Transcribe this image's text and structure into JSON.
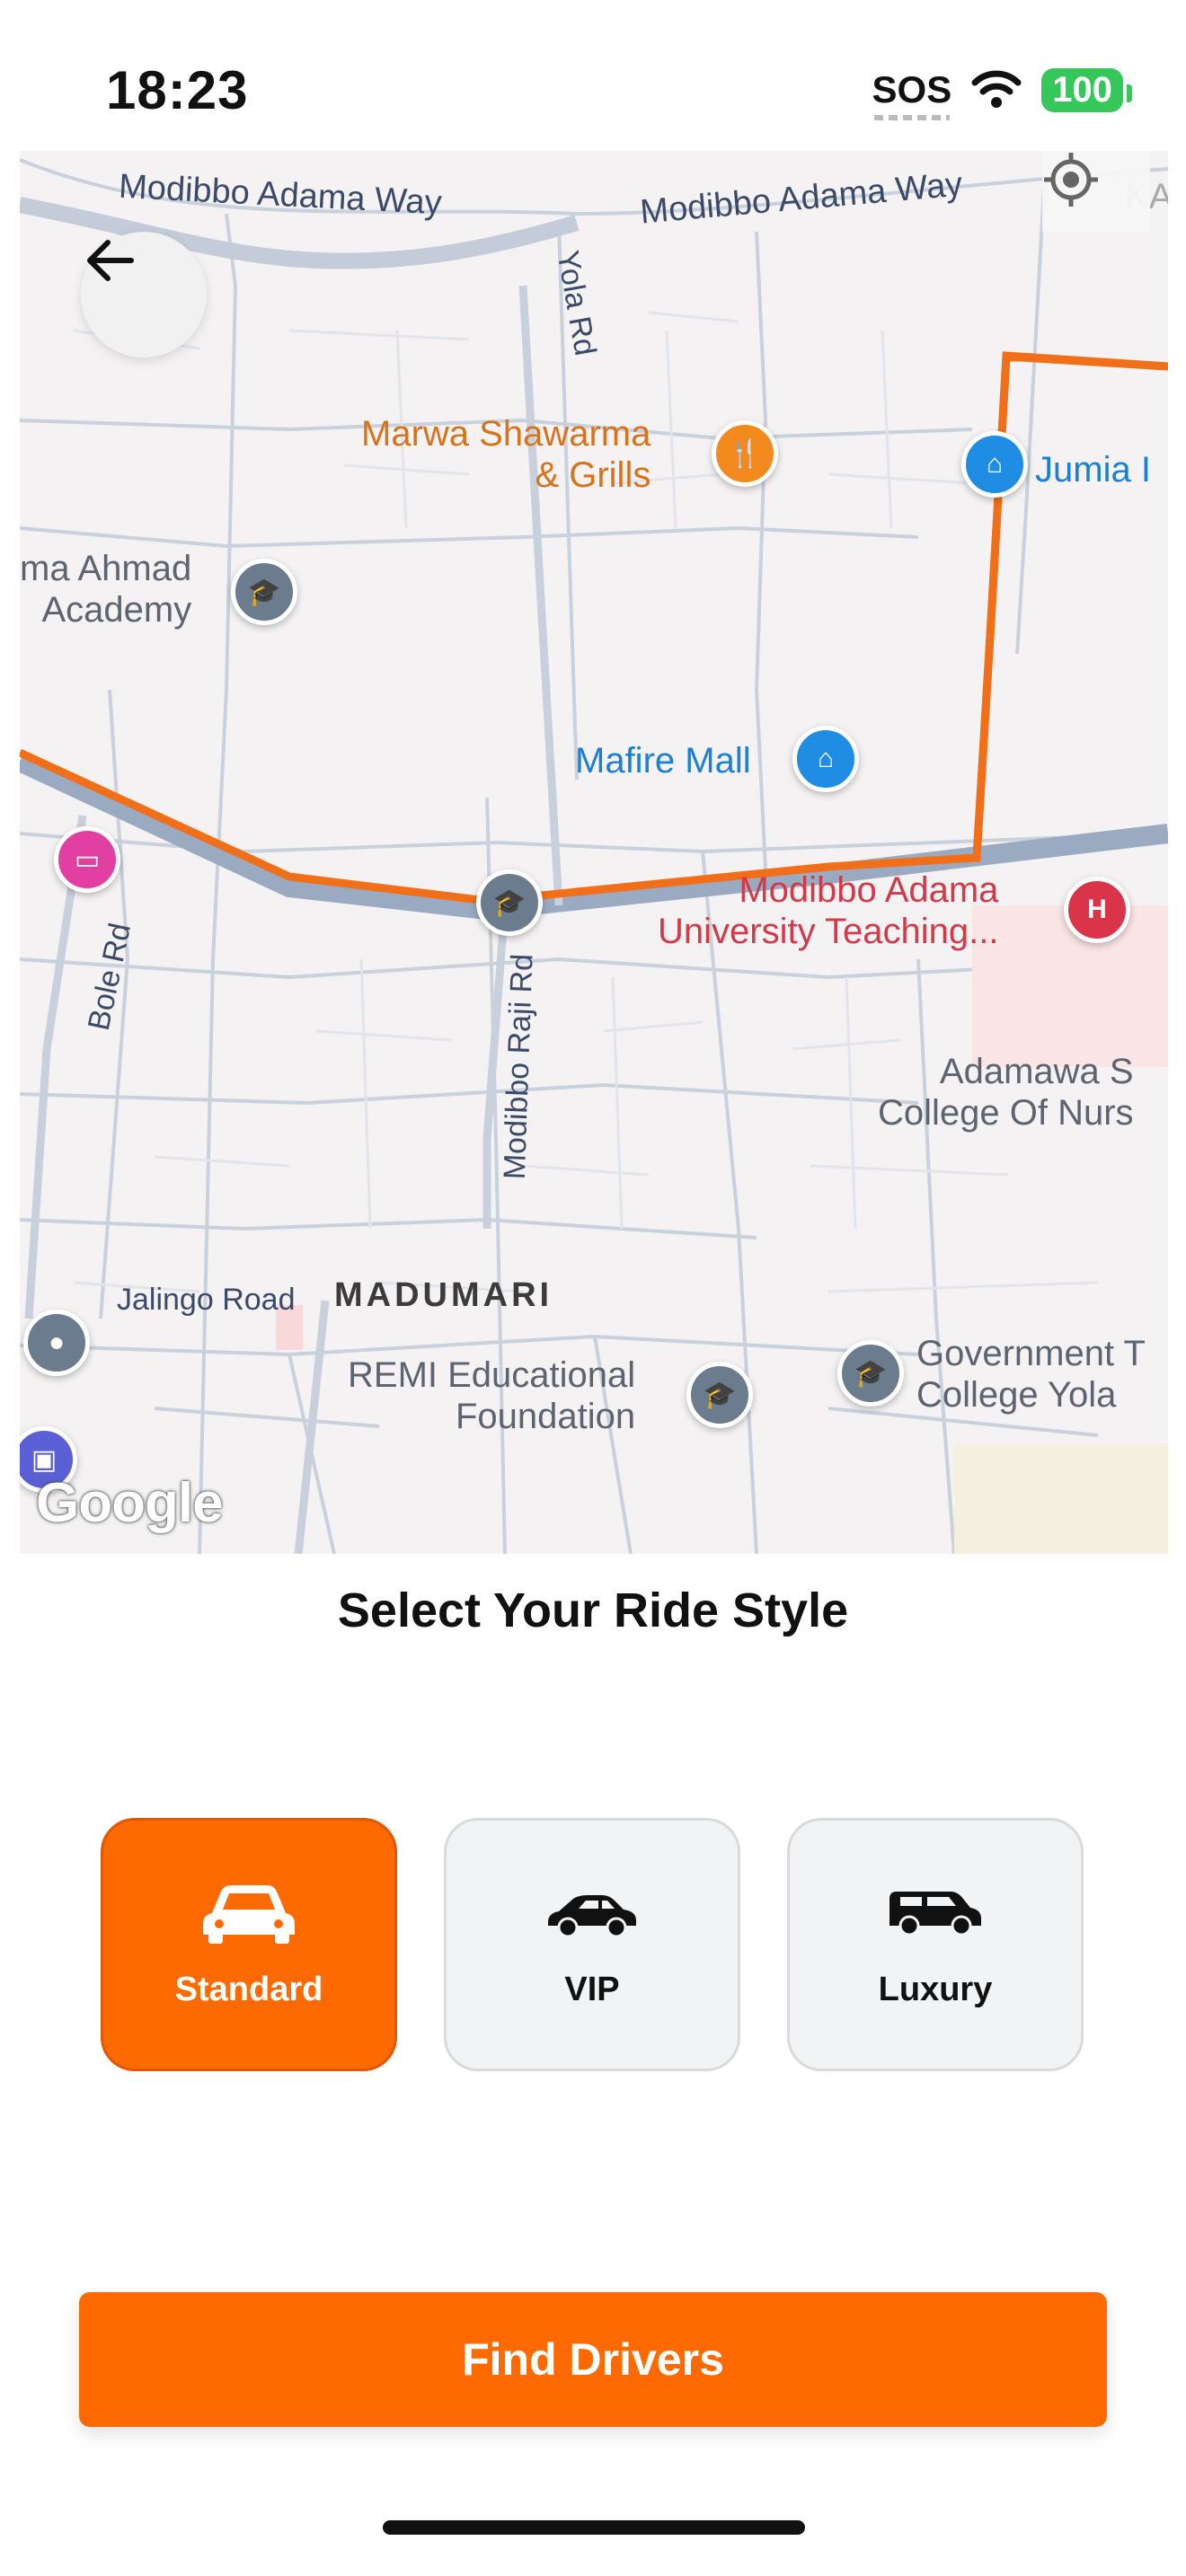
{
  "status_bar": {
    "time": "18:23",
    "sos": "SOS",
    "battery": "100",
    "icons": [
      "wifi-icon",
      "battery-icon"
    ]
  },
  "map": {
    "roads": {
      "modibbo_adama_way_1": "Modibbo Adama Way",
      "modibbo_adama_way_2": "Modibbo Adama Way",
      "yola_rd": "Yola Rd",
      "bole_rd": "Bole Rd",
      "modibbo_raji_rd": "Modibbo Raji Rd",
      "jalingo_road": "Jalingo Road"
    },
    "area": "MADUMARI",
    "pois": {
      "marwa": "Marwa Shawarma\n& Grills",
      "jumia": "Jumia I",
      "academy": "ma Ahmad\nAcademy",
      "mafire": "Mafire Mall",
      "hospital": "Modibbo Adama\nUniversity Teaching...",
      "nursing": "Adamawa S\nCollege Of Nurs",
      "remi": "REMI Educational\nFoundation",
      "government": "Government T\nCollege Yola",
      "top_right_cut": "KA"
    },
    "attribution": "Google",
    "route_color": "#f26f1a"
  },
  "title": "Select Your Ride Style",
  "ride_options": [
    {
      "label": "Standard",
      "icon": "car-front-icon",
      "selected": true
    },
    {
      "label": "VIP",
      "icon": "sedan-icon",
      "selected": false
    },
    {
      "label": "Luxury",
      "icon": "suv-icon",
      "selected": false
    }
  ],
  "find_button": "Find Drivers",
  "colors": {
    "accent": "#ff6a00",
    "card_bg": "#f2f3f5",
    "battery": "#35c759"
  }
}
